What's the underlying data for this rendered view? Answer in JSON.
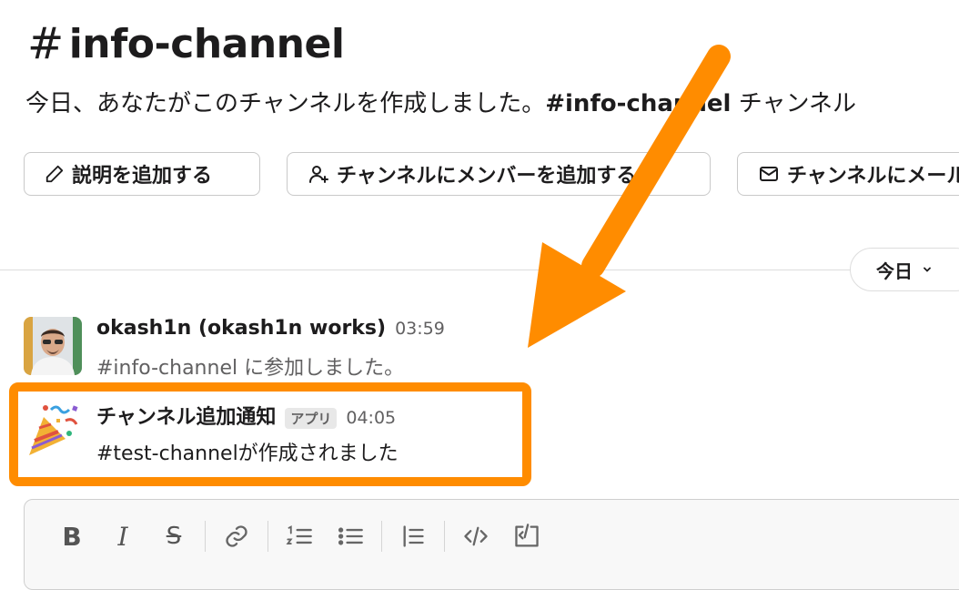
{
  "channel": {
    "hash": "#",
    "name": "info-channel",
    "intro_prefix": "今日、あなたがこのチャンネルを作成しました。",
    "intro_channel": "#info-channel",
    "intro_suffix": " チャンネル"
  },
  "actions": [
    {
      "label": "説明を追加する",
      "icon": "pencil-icon"
    },
    {
      "label": "チャンネルにメンバーを追加する",
      "icon": "add-user-icon"
    },
    {
      "label": "チャンネルにメール",
      "icon": "email-icon"
    }
  ],
  "date_pill": {
    "label": "今日",
    "icon": "chevron-down-icon"
  },
  "messages": [
    {
      "sender": "okash1n (okash1n works)",
      "time": "03:59",
      "text": "#info-channel に参加しました。",
      "avatar": "user-avatar"
    },
    {
      "sender": "チャンネル追加通知",
      "badge": "アプリ",
      "time": "04:05",
      "text": "#test-channelが作成されました",
      "avatar": "party-popper-icon"
    }
  ],
  "composer": {
    "tools": [
      "bold-icon",
      "italic-icon",
      "strikethrough-icon",
      "link-icon",
      "ordered-list-icon",
      "bulleted-list-icon",
      "blockquote-icon",
      "code-icon",
      "code-block-icon"
    ],
    "bold_glyph": "B",
    "italic_glyph": "I",
    "strike_glyph": "S"
  },
  "colors": {
    "annotation": "#ff8c00",
    "text": "#1d1c1d",
    "muted": "#616061"
  }
}
